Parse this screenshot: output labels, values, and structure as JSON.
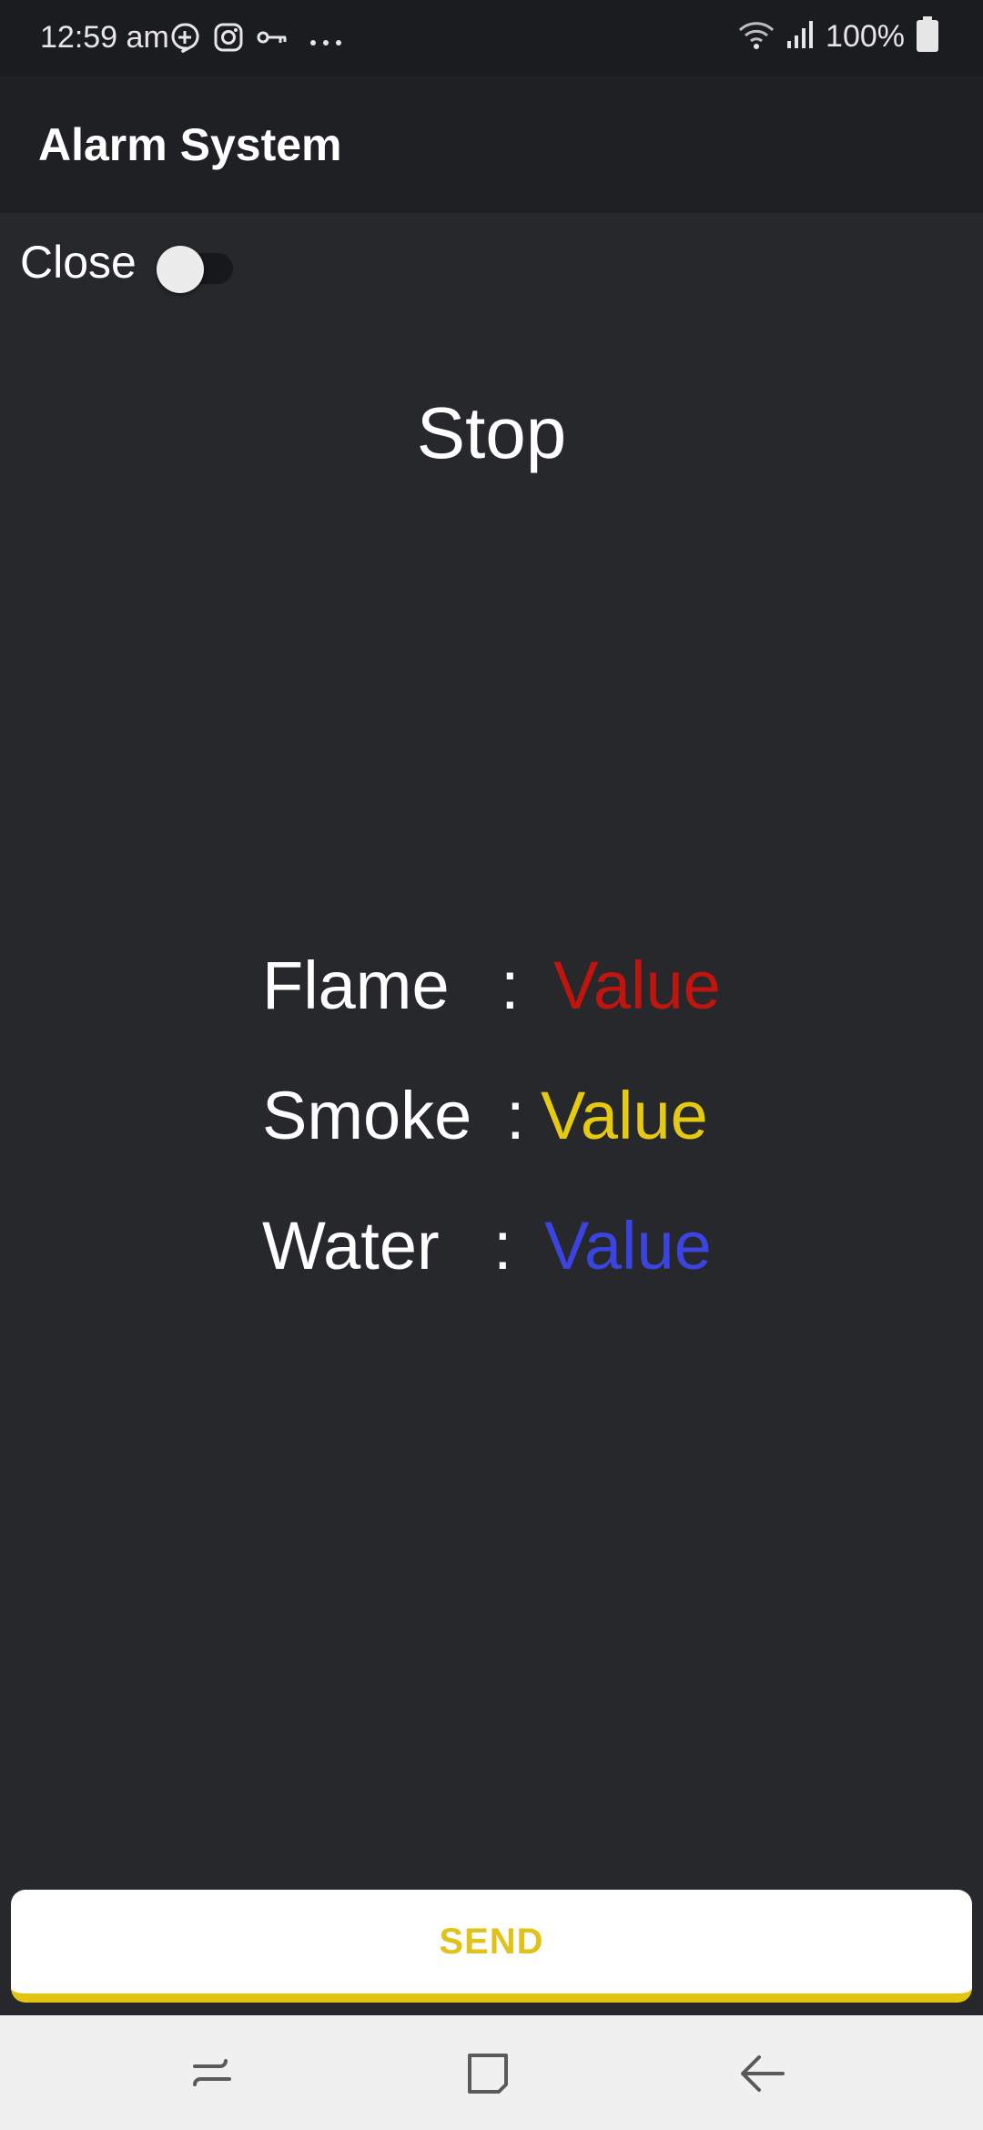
{
  "status_bar": {
    "time": "12:59 am",
    "battery": "100%",
    "icons": [
      "chat-plus-icon",
      "instagram-icon",
      "vpn-key-icon",
      "more-dots-icon",
      "wifi-icon",
      "signal-icon",
      "battery-icon"
    ]
  },
  "app_bar": {
    "title": "Alarm System"
  },
  "switch": {
    "label": "Close",
    "checked": false
  },
  "status_text": "Stop",
  "sensors": [
    {
      "label": "Flame",
      "colon": ":",
      "value": "Value",
      "color": "#c0140e"
    },
    {
      "label": "Smoke",
      "colon": ":",
      "value": "Value",
      "color": "#e6c911"
    },
    {
      "label": "Water",
      "colon": ":",
      "value": "Value",
      "color": "#3b44e0"
    }
  ],
  "send_button": {
    "label": "SEND"
  },
  "nav": {
    "icons": [
      "recent-apps-icon",
      "home-icon",
      "back-icon"
    ]
  },
  "colors": {
    "background": "#27282c",
    "app_bar": "#1f2023",
    "accent": "#e3c410"
  }
}
